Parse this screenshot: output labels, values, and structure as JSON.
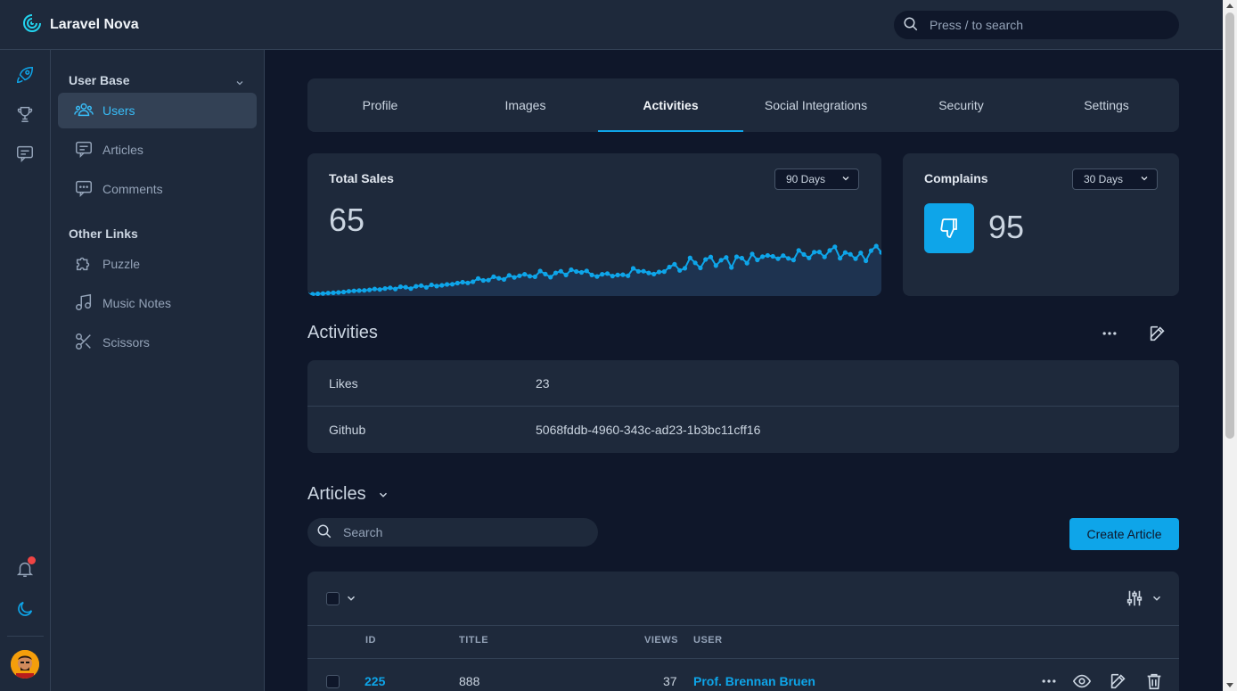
{
  "app": {
    "title": "Laravel Nova"
  },
  "search": {
    "placeholder": "Press / to search"
  },
  "rail": {
    "icons": [
      "rocket-icon",
      "trophy-icon",
      "chat-icon",
      "bell-icon",
      "moon-icon"
    ]
  },
  "sidebar": {
    "section1": "User Base",
    "section2": "Other Links",
    "items": [
      {
        "label": "Users",
        "active": true
      },
      {
        "label": "Articles"
      },
      {
        "label": "Comments"
      },
      {
        "label": "Puzzle"
      },
      {
        "label": "Music Notes"
      },
      {
        "label": "Scissors"
      }
    ]
  },
  "tabs": [
    "Profile",
    "Images",
    "Activities",
    "Social Integrations",
    "Security",
    "Settings"
  ],
  "active_tab": "Activities",
  "metrics": {
    "sales": {
      "title": "Total Sales",
      "range": "90 Days",
      "value": "65"
    },
    "complains": {
      "title": "Complains",
      "range": "30 Days",
      "value": "95"
    }
  },
  "chart_data": {
    "type": "line",
    "series": [
      {
        "values": [
          0,
          0,
          0.3,
          0.5,
          0.8,
          1,
          1.2,
          1.5,
          2,
          2.3,
          2.5,
          2.6,
          3,
          3.6,
          3.2,
          3.9,
          4.4,
          3.6,
          5.1,
          4.8,
          3.8,
          5.4,
          5.9,
          4.7,
          6.4,
          5.5,
          6.1,
          6.7,
          6.8,
          7.6,
          8.2,
          7.7,
          8.5,
          10.7,
          9.4,
          9.6,
          11.9,
          10.9,
          10.1,
          12.9,
          11.5,
          12.6,
          13.6,
          12.3,
          11.9,
          15.8,
          13.7,
          11.6,
          14.5,
          15.7,
          13.1,
          16.7,
          15.5,
          14.9,
          15.9,
          13.1,
          12.1,
          13.6,
          14.1,
          12.4,
          13.1,
          13.3,
          12.6,
          17.6,
          15.6,
          15.7,
          14.5,
          13.7,
          15.2,
          15.4,
          18.5,
          20.4,
          16.2,
          17.7,
          24.8,
          21.4,
          17.9,
          23.7,
          25.4,
          19.5,
          23.2,
          25.1,
          18.2,
          25.5,
          24.6,
          21.2,
          27.4,
          23.4,
          25.6,
          26.4,
          25.8,
          24.2,
          26.3,
          24.4,
          23.3,
          29.9,
          27.1,
          24.7,
          28.7,
          28.8,
          25.4,
          29.8,
          32.3,
          24.5,
          28.4,
          27.2,
          24.2,
          28.2,
          22.8,
          29.7,
          32.8,
          28.4
        ]
      }
    ]
  },
  "activities": {
    "title": "Activities",
    "rows": [
      {
        "key": "Likes",
        "value": "23"
      },
      {
        "key": "Github",
        "value": "5068fddb-4960-343c-ad23-1b3bc11cff16"
      }
    ]
  },
  "articles": {
    "title": "Articles",
    "search_placeholder": "Search",
    "create_label": "Create Article",
    "columns": [
      "ID",
      "TITLE",
      "VIEWS",
      "USER"
    ],
    "rows": [
      {
        "id": "225",
        "title": "888",
        "views": "37",
        "user": "Prof. Brennan Bruen"
      }
    ]
  },
  "colors": {
    "accent": "#0ea5e9",
    "bg": "#0f172a",
    "card": "#1e293b"
  }
}
